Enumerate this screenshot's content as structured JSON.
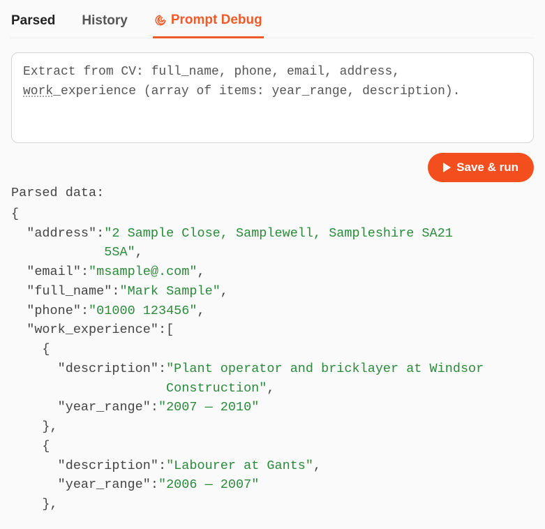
{
  "tabs": {
    "parsed": "Parsed",
    "history": "History",
    "prompt_debug": "Prompt Debug"
  },
  "prompt": {
    "line1_pre": "Extract from CV: full_name, phone, email, address,",
    "line2_underlined": "work",
    "line2_rest": "_experience (array of items: year_range, description)."
  },
  "actions": {
    "save_run": "Save & run"
  },
  "parsed": {
    "heading": "Parsed data:",
    "data": {
      "address": "2 Sample Close, Samplewell, Sampleshire SA21 5SA",
      "address_line1": "2 Sample Close, Samplewell, Sampleshire SA21",
      "address_line2": "5SA",
      "email": "msample@.com",
      "full_name": "Mark Sample",
      "phone": "01000 123456",
      "work_experience": [
        {
          "description": "Plant operator and bricklayer at Windsor Construction",
          "description_line1": "Plant operator and bricklayer at Windsor",
          "description_line2": "Construction",
          "year_range": "2007 — 2010"
        },
        {
          "description": "Labourer at Gants",
          "year_range": "2006 — 2007"
        }
      ]
    }
  },
  "colors": {
    "accent": "#f05a28",
    "json_string": "#298a3a"
  }
}
